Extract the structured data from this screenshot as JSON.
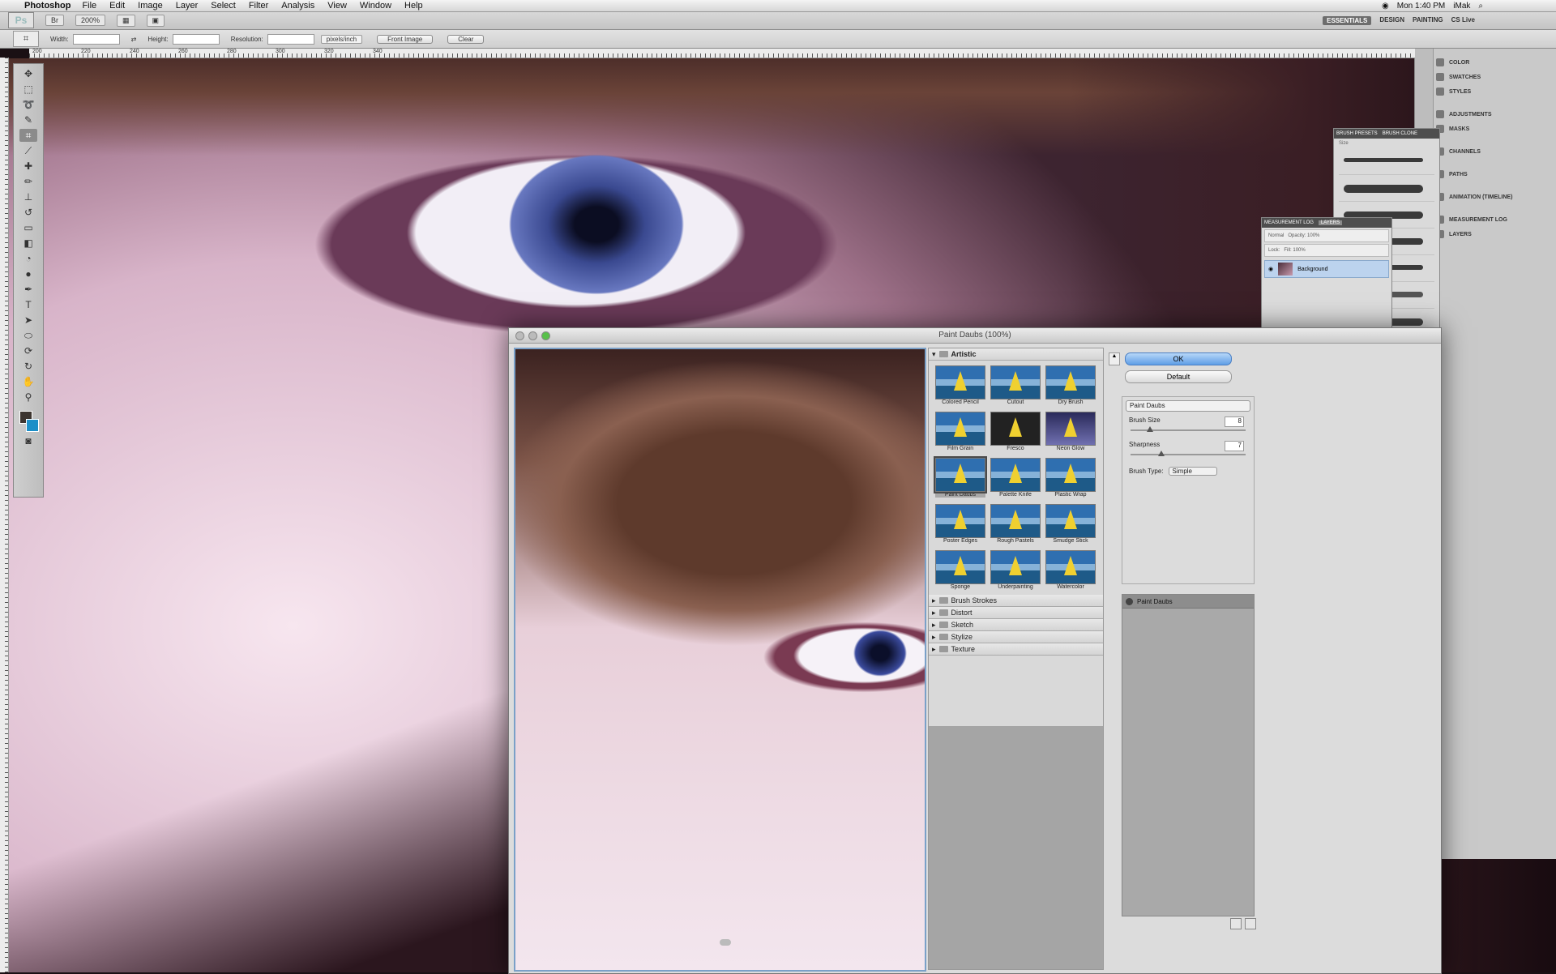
{
  "menubar": {
    "app": "Photoshop",
    "menus": [
      "File",
      "Edit",
      "Image",
      "Layer",
      "Select",
      "Filter",
      "Analysis",
      "View",
      "Window",
      "Help"
    ],
    "clock": "Mon 1:40 PM",
    "user": "iMak"
  },
  "appbar": {
    "ps_logo": "Ps",
    "zoom": "200%",
    "workspaces": [
      "ESSENTIALS",
      "DESIGN",
      "PAINTING"
    ],
    "cs_live": "CS Live"
  },
  "options": {
    "width_label": "Width:",
    "height_label": "Height:",
    "resolution_label": "Resolution:",
    "units": "pixels/inch",
    "front_image": "Front Image",
    "clear": "Clear"
  },
  "ruler_ticks": [
    "200",
    "220",
    "240",
    "260",
    "280",
    "300",
    "320",
    "340"
  ],
  "dock": {
    "items": [
      "COLOR",
      "SWATCHES",
      "STYLES",
      "ADJUSTMENTS",
      "MASKS",
      "CHANNELS",
      "PATHS",
      "ANIMATION (TIMELINE)",
      "MEASUREMENT LOG",
      "LAYERS"
    ]
  },
  "brush_panel": {
    "tabs": [
      "BRUSH PRESETS",
      "BRUSH CLONE"
    ],
    "size_label": "Size"
  },
  "layers_panel": {
    "tabs": [
      "MEASUREMENT LOG",
      "LAYERS"
    ],
    "mode": "Normal",
    "opacity": "Opacity: 100%",
    "lock": "Lock:",
    "fill": "Fill: 100%",
    "layer_name": "Background"
  },
  "dialog": {
    "title": "Paint Daubs (100%)",
    "open_category": "Artistic",
    "filters": [
      "Colored Pencil",
      "Cutout",
      "Dry Brush",
      "Film Grain",
      "Fresco",
      "Neon Glow",
      "Paint Daubs",
      "Palette Knife",
      "Plastic Wrap",
      "Poster Edges",
      "Rough Pastels",
      "Smudge Stick",
      "Sponge",
      "Underpainting",
      "Watercolor"
    ],
    "selected_filter": "Paint Daubs",
    "categories": [
      "Brush Strokes",
      "Distort",
      "Sketch",
      "Stylize",
      "Texture"
    ],
    "ok": "OK",
    "default": "Default",
    "filter_dropdown": "Paint Daubs",
    "brush_size_label": "Brush Size",
    "brush_size_value": "8",
    "sharpness_label": "Sharpness",
    "sharpness_value": "7",
    "brush_type_label": "Brush Type:",
    "brush_type_value": "Simple",
    "applied_effect": "Paint Daubs"
  }
}
